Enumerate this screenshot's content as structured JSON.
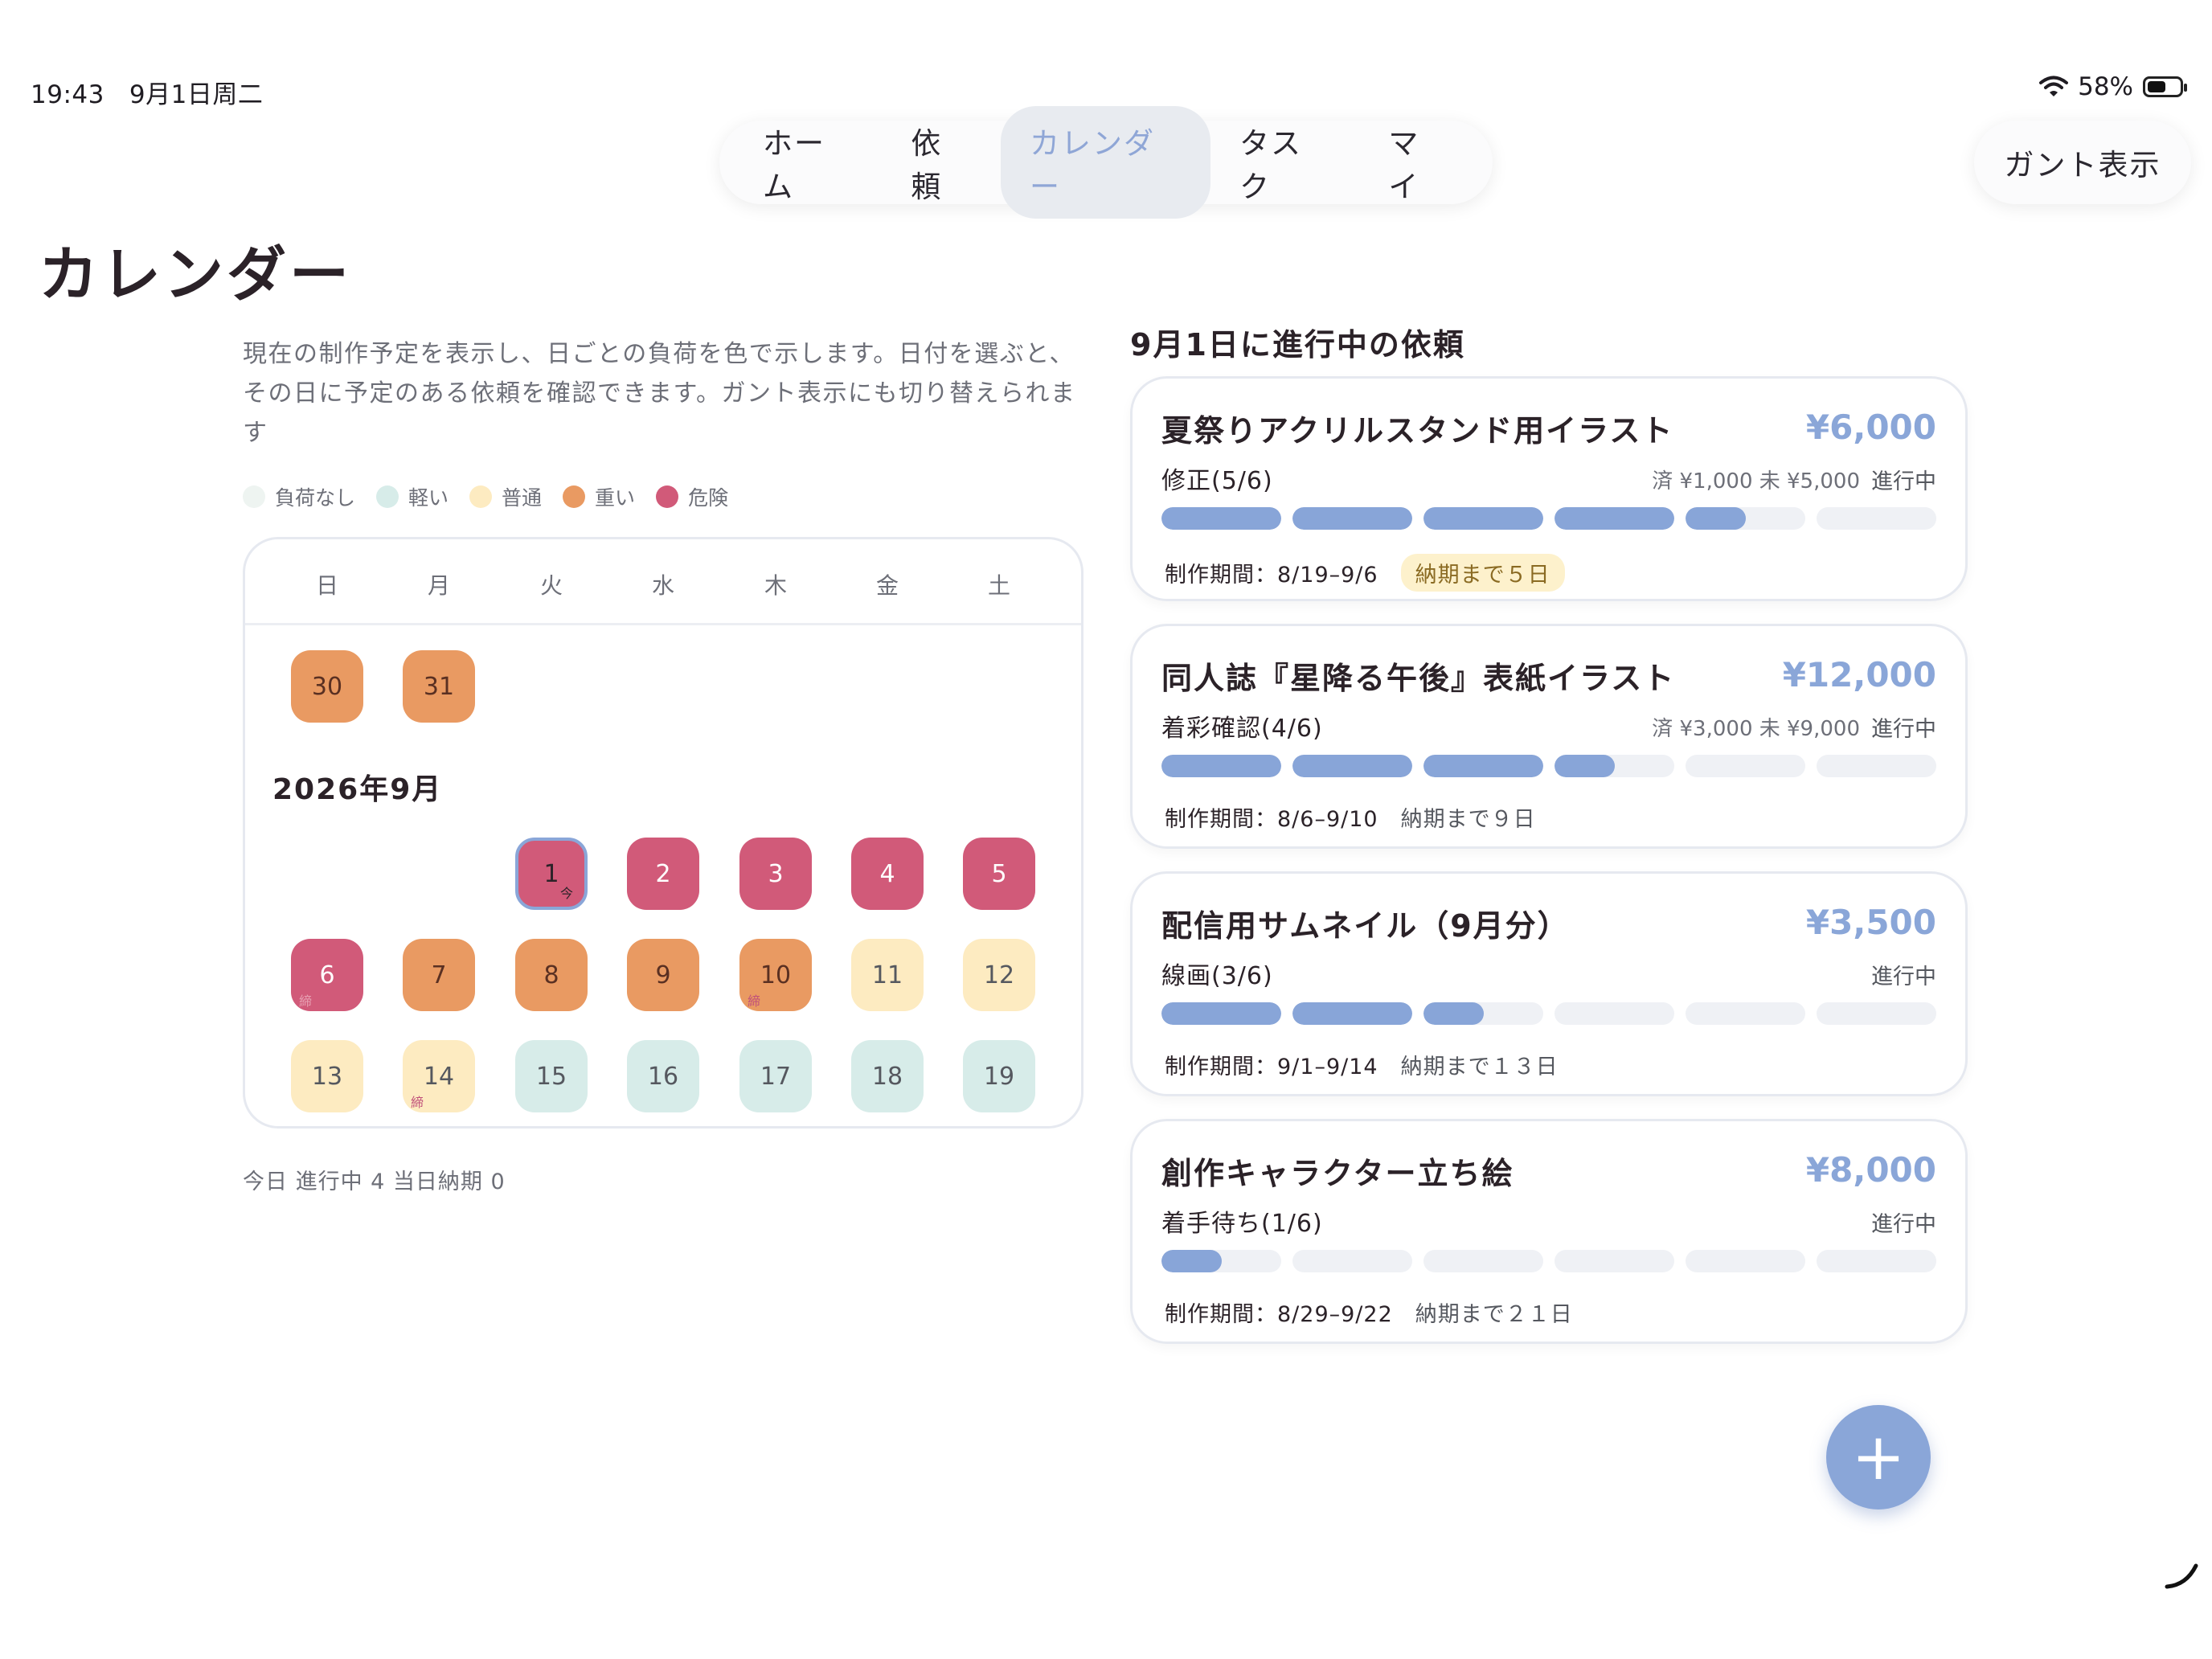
{
  "status": {
    "time": "19:43",
    "date": "9月1日周二",
    "battery": "58%",
    "battery_level": 0.58
  },
  "nav": {
    "tabs": [
      {
        "label": "ホーム"
      },
      {
        "label": "依頼"
      },
      {
        "label": "カレンダー",
        "active": true
      },
      {
        "label": "タスク"
      },
      {
        "label": "マイ"
      }
    ],
    "gantt_button": "ガント表示"
  },
  "page": {
    "title": "カレンダー",
    "description": "現在の制作予定を表示し、日ごとの負荷を色で示します。日付を選ぶと、その日に予定のある依頼を確認できます。ガント表示にも切り替えられます"
  },
  "legend": [
    {
      "label": "負荷なし",
      "color": "#eef4f1"
    },
    {
      "label": "軽い",
      "color": "#d7ece9"
    },
    {
      "label": "普通",
      "color": "#fdebc1"
    },
    {
      "label": "重い",
      "color": "#e99a62"
    },
    {
      "label": "危険",
      "color": "#d15a79"
    }
  ],
  "calendar": {
    "weekdays": [
      "日",
      "月",
      "火",
      "水",
      "木",
      "金",
      "土"
    ],
    "month_label": "2026年9月",
    "today_mark": "今",
    "deadline_mark": "締",
    "prev_month_days": [
      {
        "day": "30",
        "level": "heavy"
      },
      {
        "day": "31",
        "level": "heavy"
      }
    ],
    "days": [
      {
        "day": "1",
        "level": "danger",
        "today": true
      },
      {
        "day": "2",
        "level": "danger"
      },
      {
        "day": "3",
        "level": "danger"
      },
      {
        "day": "4",
        "level": "danger"
      },
      {
        "day": "5",
        "level": "danger"
      },
      {
        "day": "6",
        "level": "danger",
        "deadline": true
      },
      {
        "day": "7",
        "level": "heavy"
      },
      {
        "day": "8",
        "level": "heavy"
      },
      {
        "day": "9",
        "level": "heavy"
      },
      {
        "day": "10",
        "level": "heavy",
        "deadline": true
      },
      {
        "day": "11",
        "level": "normal"
      },
      {
        "day": "12",
        "level": "normal"
      },
      {
        "day": "13",
        "level": "normal"
      },
      {
        "day": "14",
        "level": "normal",
        "deadline": true
      },
      {
        "day": "15",
        "level": "light"
      },
      {
        "day": "16",
        "level": "light"
      },
      {
        "day": "17",
        "level": "light"
      },
      {
        "day": "18",
        "level": "light"
      },
      {
        "day": "19",
        "level": "light"
      }
    ],
    "footer": "今日  進行中 4  当日納期 0"
  },
  "right_panel": {
    "title": "9月1日に進行中の依頼",
    "cards": [
      {
        "title": "夏祭りアクリルスタンド用イラスト",
        "price": "¥6,000",
        "stage": "修正(5/6)",
        "paid": "済 ¥1,000 未 ¥5,000",
        "status": "進行中",
        "progress": [
          1,
          1,
          1,
          1,
          0.5,
          0
        ],
        "period": "制作期間：8/19–9/6",
        "due": "納期まで５日",
        "due_warn": true
      },
      {
        "title": "同人誌『星降る午後』表紙イラスト",
        "price": "¥12,000",
        "stage": "着彩確認(4/6)",
        "paid": "済 ¥3,000 未 ¥9,000",
        "status": "進行中",
        "progress": [
          1,
          1,
          1,
          0.5,
          0,
          0
        ],
        "period": "制作期間：8/6–9/10",
        "due": "納期まで９日",
        "due_warn": false
      },
      {
        "title": "配信用サムネイル（9月分）",
        "price": "¥3,500",
        "stage": "線画(3/6)",
        "paid": "",
        "status": "進行中",
        "progress": [
          1,
          1,
          0.5,
          0,
          0,
          0
        ],
        "period": "制作期間：9/1–9/14",
        "due": "納期まで１３日",
        "due_warn": false
      },
      {
        "title": "創作キャラクター立ち絵",
        "price": "¥8,000",
        "stage": "着手待ち(1/6)",
        "paid": "",
        "status": "進行中",
        "progress": [
          0.5,
          0,
          0,
          0,
          0,
          0
        ],
        "period": "制作期間：8/29–9/22",
        "due": "納期まで２１日",
        "due_warn": false
      }
    ]
  },
  "fab": {
    "label": "+"
  }
}
